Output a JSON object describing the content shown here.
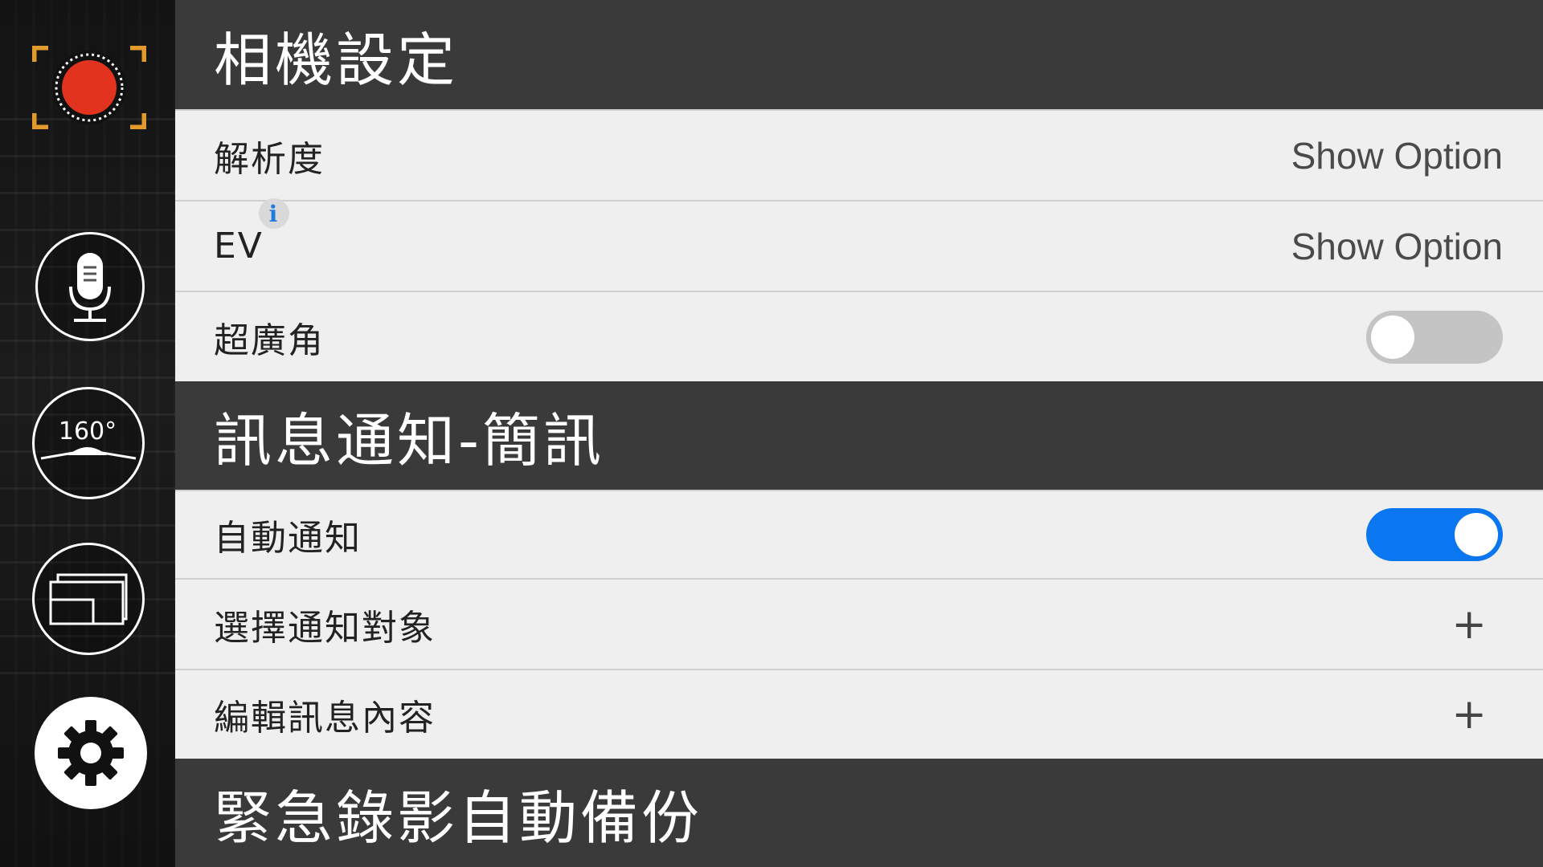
{
  "sidebar": {
    "record_icon": "record-icon",
    "mic_icon": "microphone-icon",
    "angle_label": "160°",
    "angle_icon": "wide-angle-icon",
    "screen_icon": "screen-layout-icon",
    "settings_icon": "gear-icon"
  },
  "sections": {
    "camera": {
      "title": "相機設定",
      "resolution": {
        "label": "解析度",
        "value": "Show Option"
      },
      "ev": {
        "label": "EV",
        "info_icon": "info-icon",
        "info_glyph": "i",
        "value": "Show Option"
      },
      "ultra_wide": {
        "label": "超廣角",
        "enabled": false
      }
    },
    "sms": {
      "title": "訊息通知-簡訊",
      "auto_notify": {
        "label": "自動通知",
        "enabled": true
      },
      "select_recipients": {
        "label": "選擇通知對象",
        "action": "+"
      },
      "edit_message": {
        "label": "編輯訊息內容",
        "action": "+"
      }
    },
    "backup": {
      "title": "緊急錄影自動備份"
    }
  },
  "colors": {
    "header_bg": "#3a3a3a",
    "row_bg": "#efefef",
    "toggle_on": "#0a76f0",
    "toggle_off": "#c4c4c4",
    "record_red": "#e2331e",
    "record_bracket": "#e39a2d"
  }
}
